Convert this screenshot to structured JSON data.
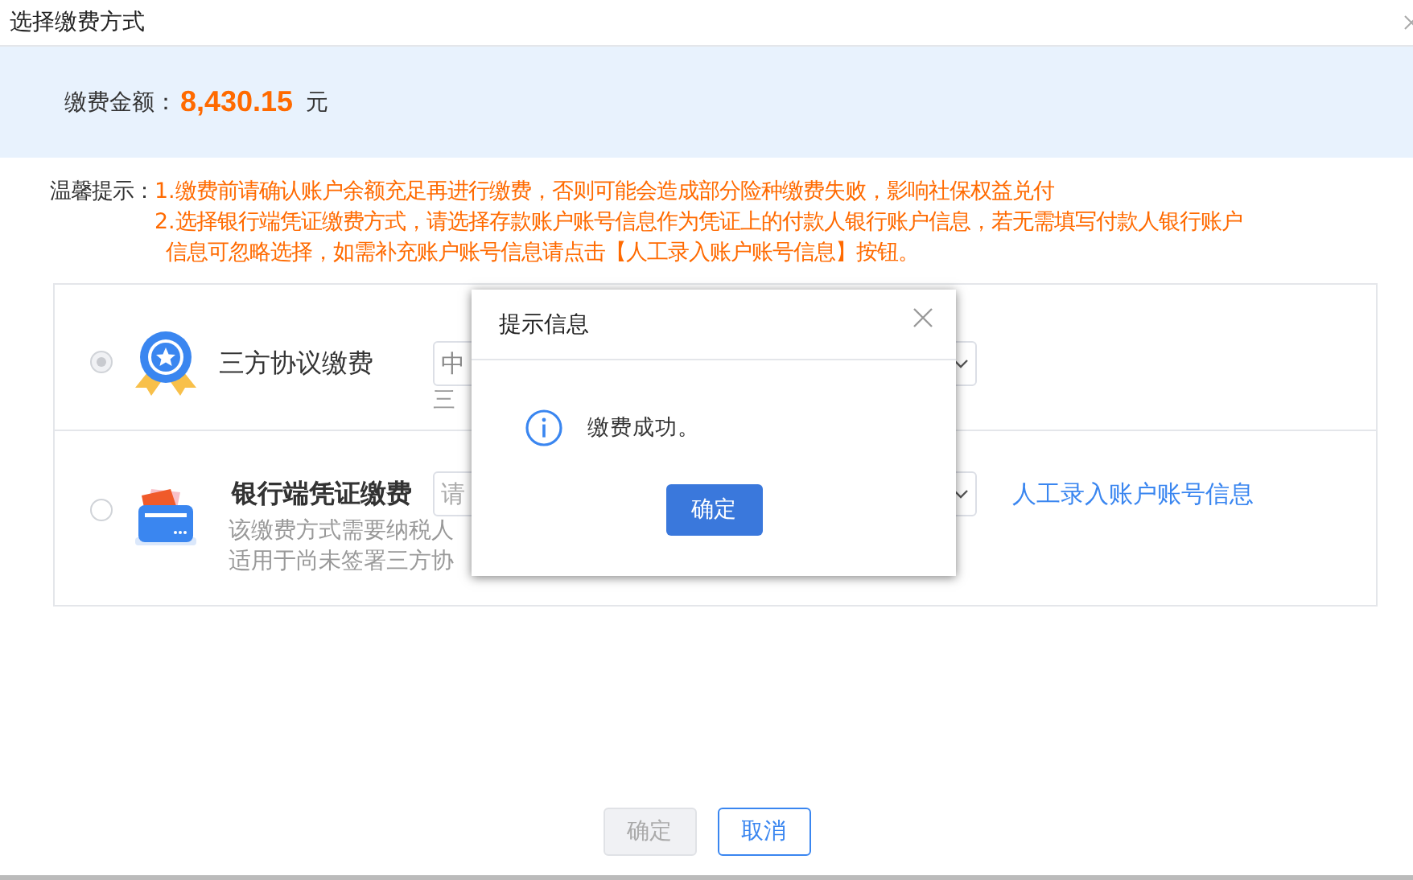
{
  "window": {
    "title": "选择缴费方式"
  },
  "amount": {
    "label": "缴费金额：",
    "value": "8,430.15",
    "unit": "元"
  },
  "tips": {
    "label": "温馨提示：",
    "lines": [
      "1.缴费前请确认账户余额充足再进行缴费，否则可能会造成部分险种缴费失败，影响社保权益兑付",
      "2.选择银行端凭证缴费方式，请选择存款账户账号信息作为凭证上的付款人银行账户信息，若无需填写付款人银行账户",
      "信息可忽略选择，如需补充账户账号信息请点击【人工录入账户账号信息】按钮。"
    ]
  },
  "options": [
    {
      "kind": "medal",
      "title": "三方协议缴费",
      "selected": true,
      "disabled": true,
      "select_value": "中",
      "description": [
        "三"
      ]
    },
    {
      "kind": "card",
      "title": "银行端凭证缴费",
      "selected": false,
      "disabled": false,
      "select_placeholder": "请",
      "link": "人工录入账户账号信息",
      "description": [
        "该缴费方式需要纳税人",
        "适用于尚未签署三方协"
      ]
    }
  ],
  "footer_buttons": [
    {
      "label": "确定",
      "disabled": true
    },
    {
      "label": "取消",
      "disabled": false
    }
  ],
  "dialog": {
    "title": "提示信息",
    "message": "缴费成功。",
    "button": "确定"
  }
}
